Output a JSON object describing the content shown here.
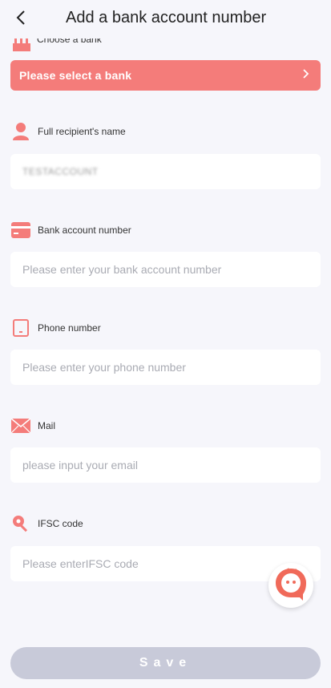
{
  "header": {
    "title": "Add a bank account number"
  },
  "bank": {
    "label": "Choose a bank",
    "select_text": "Please select a bank",
    "icon": "bank-icon"
  },
  "recipient": {
    "label": "Full recipient's name",
    "value": "TESTACCOUNT",
    "icon": "person-icon"
  },
  "account": {
    "label": "Bank account number",
    "placeholder": "Please enter your bank account number",
    "icon": "card-icon"
  },
  "phone": {
    "label": "Phone number",
    "placeholder": "Please enter your phone number",
    "icon": "phone-icon"
  },
  "mail": {
    "label": "Mail",
    "placeholder": "please input your email",
    "icon": "mail-icon"
  },
  "ifsc": {
    "label": "IFSC code",
    "placeholder": "Please enterIFSC code",
    "icon": "key-icon"
  },
  "save_label": "Save",
  "colors": {
    "accent": "#f47c7a",
    "background": "#f6f6fb",
    "save_disabled": "#c8cad9",
    "placeholder": "#a9abb3"
  }
}
